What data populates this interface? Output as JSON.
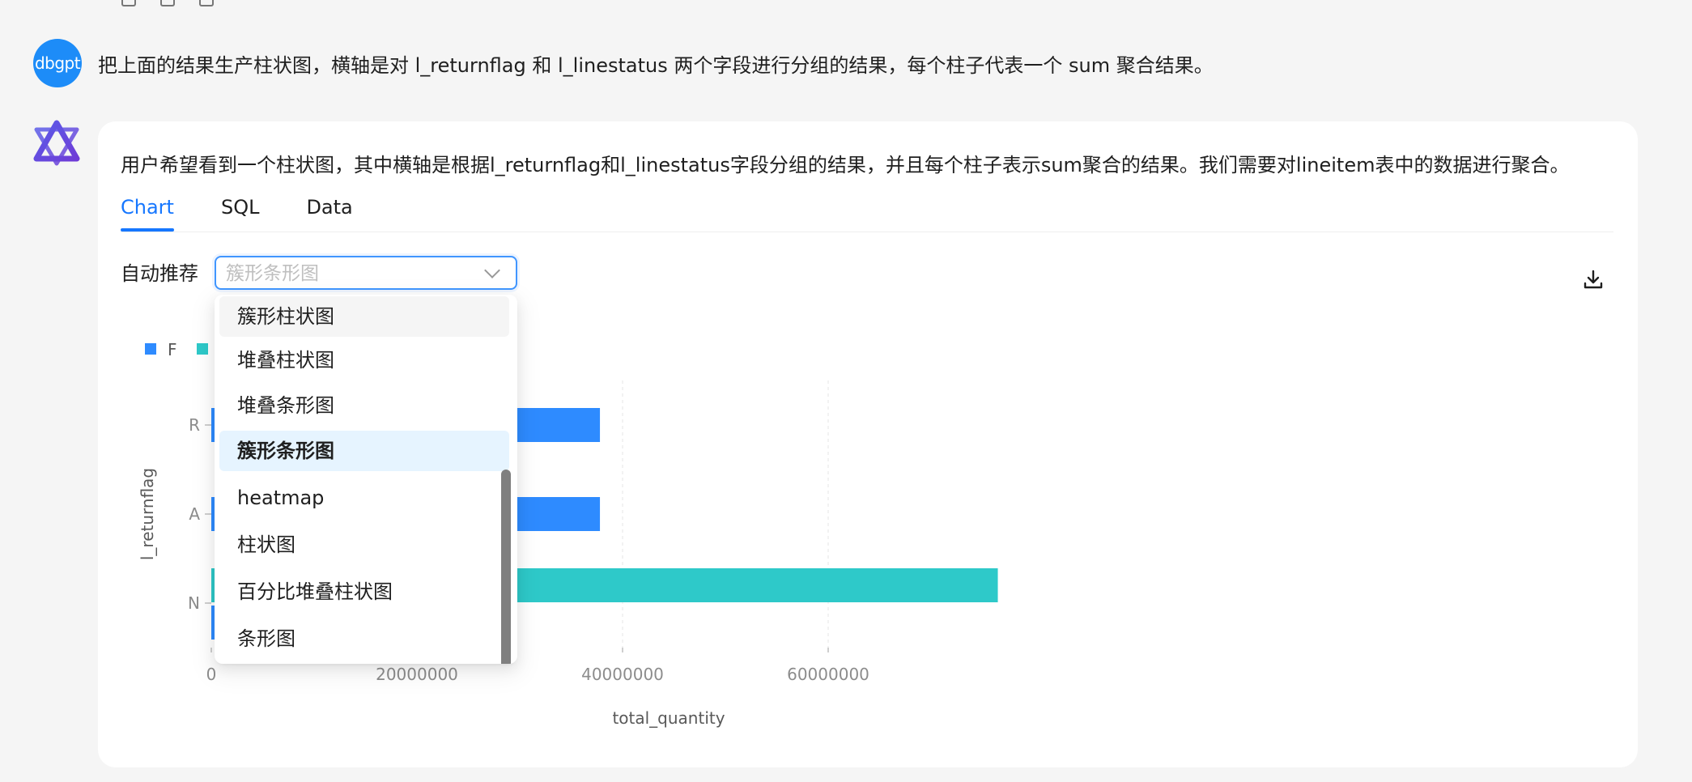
{
  "user": {
    "avatar_text": "dbgpt",
    "message": "把上面的结果生产柱状图，横轴是对 l_returnflag 和 l_linestatus 两个字段进行分组的结果，每个柱子代表一个 sum 聚合结果。"
  },
  "bot": {
    "message": "用户希望看到一个柱状图，其中横轴是根据l_returnflag和l_linestatus字段分组的结果，并且每个柱子表示sum聚合的结果。我们需要对lineitem表中的数据进行聚合。"
  },
  "tabs": [
    {
      "label": "Chart",
      "active": true
    },
    {
      "label": "SQL",
      "active": false
    },
    {
      "label": "Data",
      "active": false
    }
  ],
  "chart_select": {
    "label": "自动推荐",
    "placeholder": "簇形条形图",
    "options": [
      "簇形柱状图",
      "堆叠柱状图",
      "堆叠条形图",
      "簇形条形图",
      "heatmap",
      "柱状图",
      "百分比堆叠柱状图",
      "条形图"
    ],
    "selected": "簇形条形图",
    "hovered": "簇形柱状图"
  },
  "colors": {
    "accent": "#1677ff",
    "series_F": "#2e8bff",
    "series_O": "#2ec9c9"
  },
  "chart_data": {
    "type": "bar",
    "orientation": "horizontal",
    "categories": [
      "R",
      "A",
      "N"
    ],
    "series": [
      {
        "name": "F",
        "values": [
          37800000,
          37800000,
          1000000
        ]
      },
      {
        "name": "",
        "values": [
          0,
          0,
          76500000
        ]
      }
    ],
    "xlabel": "total_quantity",
    "ylabel": "l_returnflag",
    "xticks": [
      "0",
      "20000000",
      "40000000",
      "60000000"
    ],
    "xlim": [
      0,
      100000000
    ],
    "grid": true,
    "legend": "top-left"
  }
}
